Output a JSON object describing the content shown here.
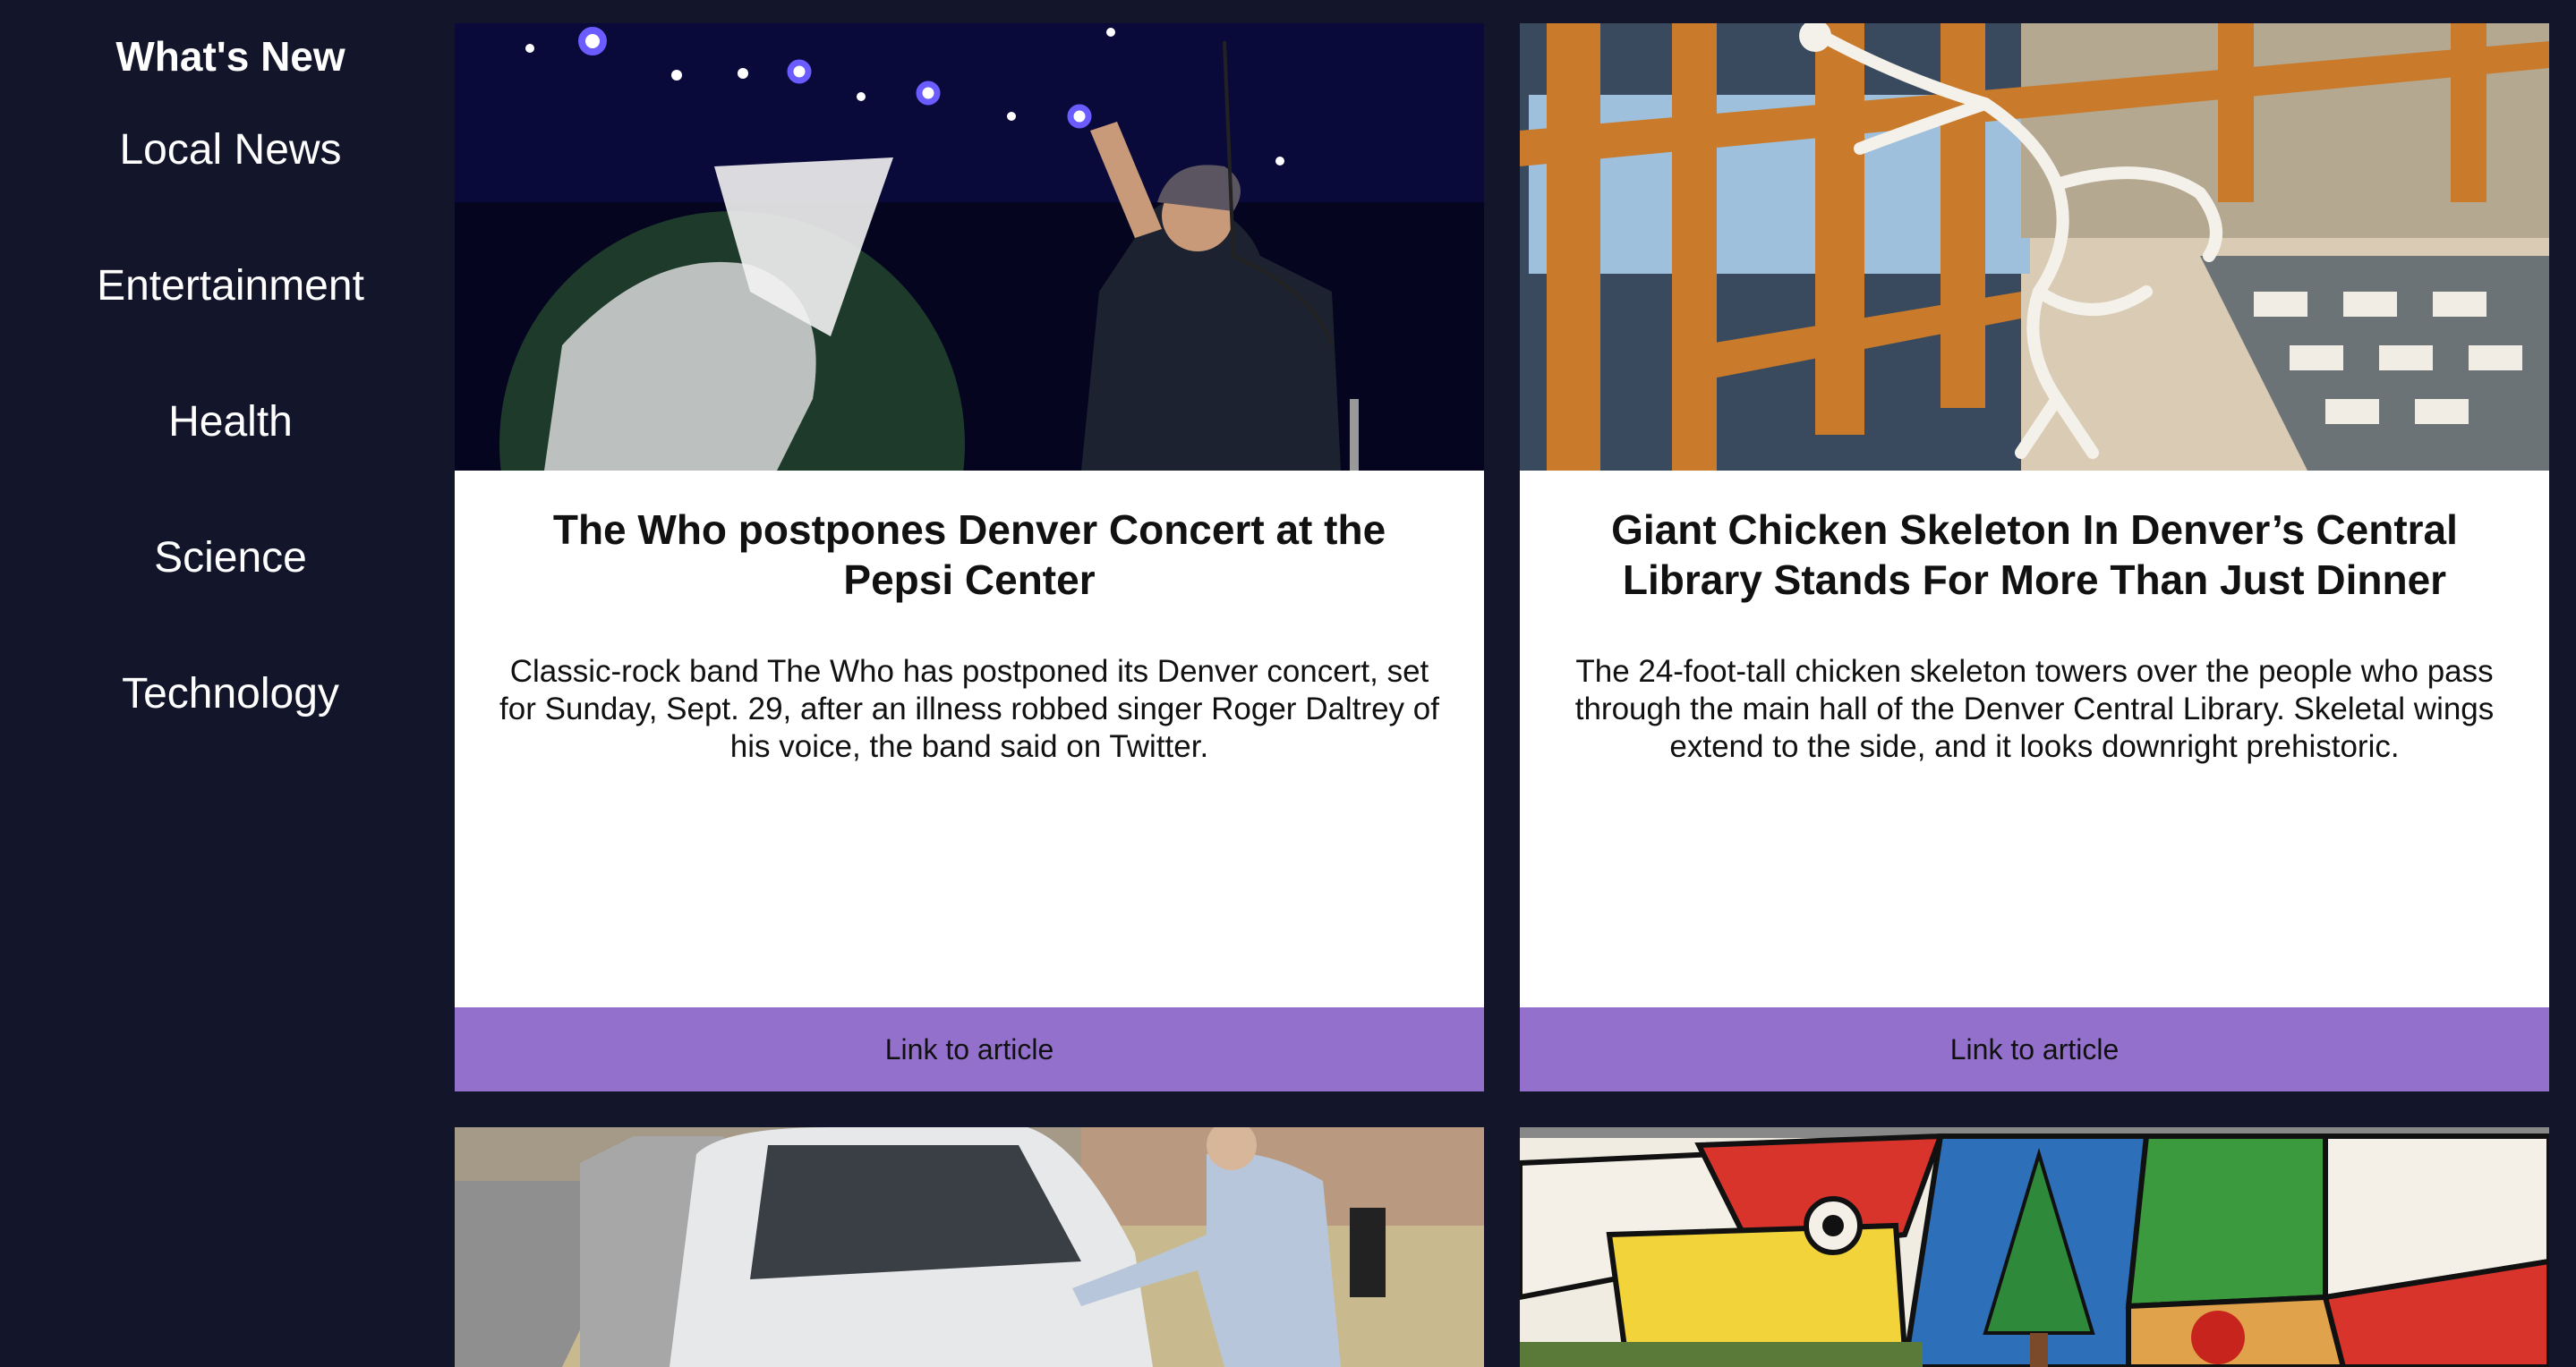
{
  "sidebar": {
    "heading": "What's New",
    "items": [
      {
        "label": "Local News"
      },
      {
        "label": "Entertainment"
      },
      {
        "label": "Health"
      },
      {
        "label": "Science"
      },
      {
        "label": "Technology"
      }
    ]
  },
  "articles": [
    {
      "image": "concert-photo",
      "title": "The Who postpones Denver Concert at the Pepsi Center",
      "summary": "Classic-rock band The Who has postponed its Denver concert, set for Sunday, Sept. 29, after an illness robbed singer Roger Daltrey of his voice, the band said on Twitter.",
      "link_label": "Link to article"
    },
    {
      "image": "library-skeleton-photo",
      "title": "Giant Chicken Skeleton In Denver’s Central Library Stands For More Than Just Dinner",
      "summary": "The 24-foot-tall chicken skeleton towers over the people who pass through the main hall of the Denver Central Library. Skeletal wings extend to the side, and it looks downright prehistoric.",
      "link_label": "Link to article"
    },
    {
      "image": "parked-car-photo"
    },
    {
      "image": "mural-photo"
    }
  ],
  "colors": {
    "background": "#13152a",
    "link_bar": "#9370cb",
    "card": "#ffffff"
  }
}
